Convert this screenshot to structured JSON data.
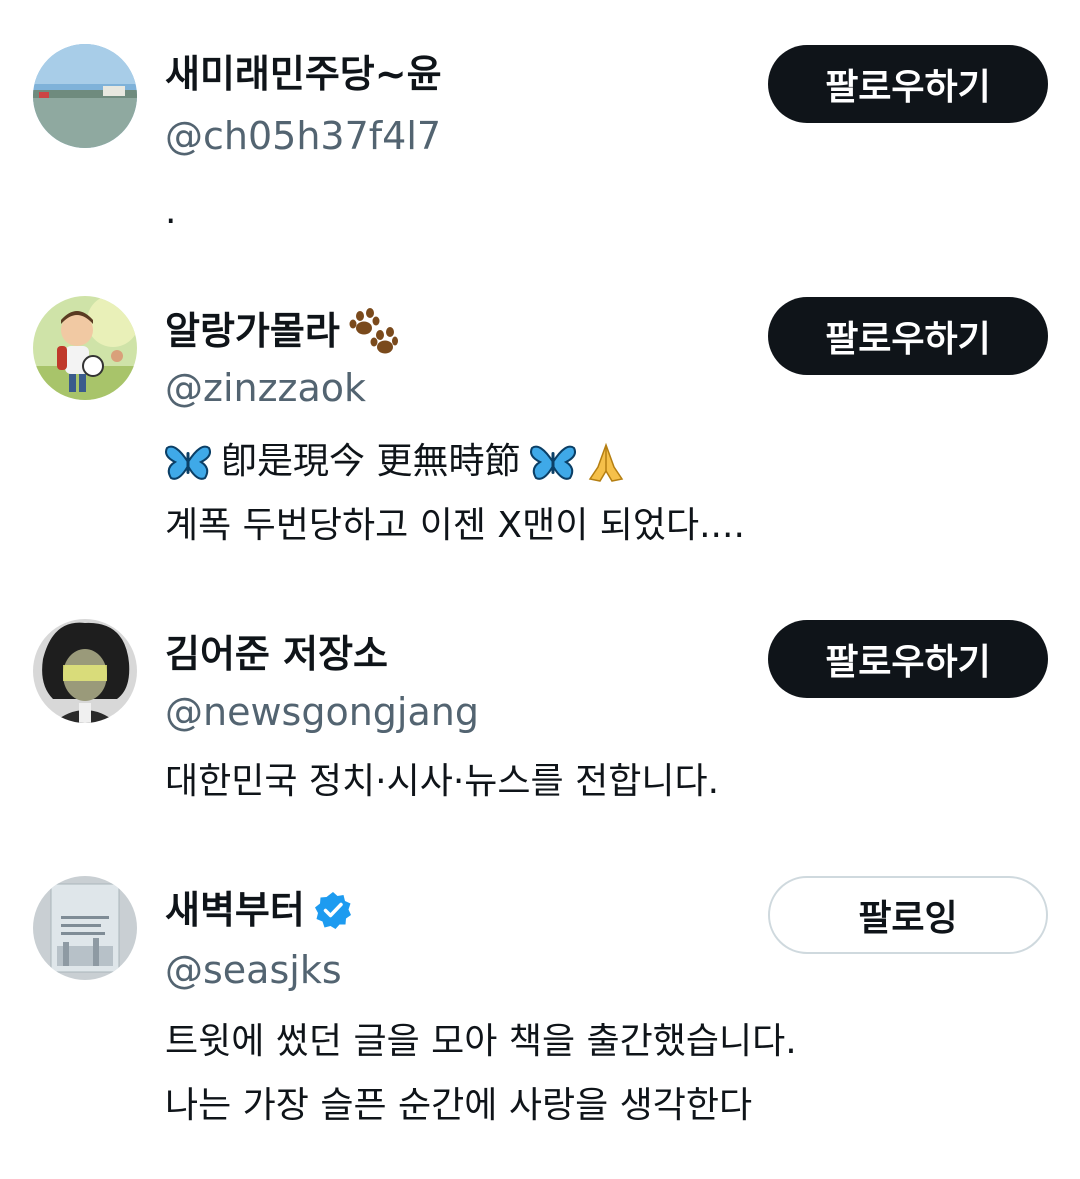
{
  "users": [
    {
      "display_name": "새미래민주당~윤",
      "handle": "@ch05h37f4l7",
      "bio_lines": [
        "."
      ],
      "follow_label": "팔로우하기",
      "following": false
    },
    {
      "display_name": "알랑가몰라",
      "name_emoji": "paw-prints-icon",
      "handle": "@zinzzaok",
      "bio_line1_text": "卽是現今 更無時節",
      "bio_line1_emojis": [
        "butterfly-icon",
        "butterfly-icon",
        "folded-hands-icon"
      ],
      "bio_line2": "계폭 두번당하고 이젠 X맨이 되었다....",
      "follow_label": "팔로우하기",
      "following": false
    },
    {
      "display_name": "김어준 저장소",
      "handle": "@newsgongjang",
      "bio_lines": [
        "대한민국 정치·시사·뉴스를 전합니다."
      ],
      "follow_label": "팔로우하기",
      "following": false
    },
    {
      "display_name": "새벽부터",
      "name_badge": "verified-badge-icon",
      "handle": "@seasjks",
      "bio_lines": [
        "트윗에 썼던 글을 모아 책을 출간했습니다.",
        "나는 가장 슬픈 순간에 사랑을 생각한다"
      ],
      "follow_label": "팔로잉",
      "following": true
    }
  ],
  "colors": {
    "follow_button_bg": "#0f1419",
    "handle_text": "#536471",
    "verified_blue": "#1d9bf0",
    "highlight": "#fff48c"
  }
}
